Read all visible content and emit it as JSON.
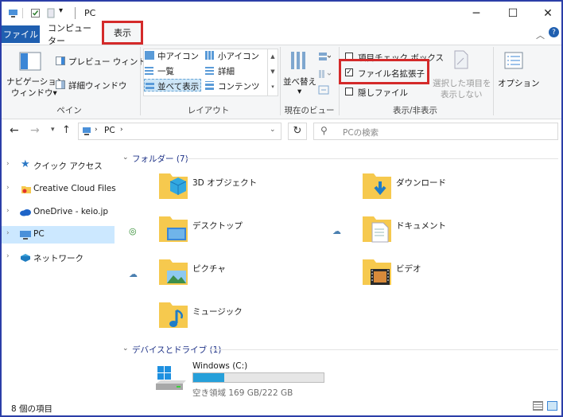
{
  "titlebar": {
    "title": "PC"
  },
  "tabs": {
    "file": "ファイル",
    "computer": "コンピューター",
    "view": "表示"
  },
  "ribbon": {
    "pane": {
      "nav_pane_line1": "ナビゲーション",
      "nav_pane_line2": "ウィンドウ▾",
      "preview": "プレビュー ウィンドウ",
      "details": "詳細ウィンドウ",
      "label": "ペイン"
    },
    "layout": {
      "medium_icons": "中アイコン",
      "small_icons": "小アイコン",
      "list": "一覧",
      "details": "詳細",
      "tiles": "並べて表示",
      "content": "コンテンツ",
      "label": "レイアウト"
    },
    "current_view": {
      "sort_line1": "並べ替え",
      "sort_line2": "▾",
      "label": "現在のビュー"
    },
    "show_hide": {
      "item_checkboxes": "項目チェック ボックス",
      "file_extensions": "ファイル名拡張子",
      "hidden_items": "隠しファイル",
      "hide_selected_line1": "選択した項目を",
      "hide_selected_line2": "表示しない",
      "label": "表示/非表示"
    },
    "options": {
      "label": "オプション"
    }
  },
  "address": {
    "path": "PC",
    "search_placeholder": "PCの検索"
  },
  "nav": {
    "items": [
      {
        "label": "クイック アクセス"
      },
      {
        "label": "Creative Cloud Files"
      },
      {
        "label": "OneDrive - keio.jp"
      },
      {
        "label": "PC"
      },
      {
        "label": "ネットワーク"
      }
    ]
  },
  "content": {
    "folders_header": "フォルダー (7)",
    "folders": [
      {
        "label": "3D オブジェクト"
      },
      {
        "label": "ダウンロード"
      },
      {
        "label": "デスクトップ"
      },
      {
        "label": "ドキュメント"
      },
      {
        "label": "ピクチャ"
      },
      {
        "label": "ビデオ"
      },
      {
        "label": "ミュージック"
      }
    ],
    "drives_header": "デバイスとドライブ (1)",
    "drive": {
      "name": "Windows (C:)",
      "free_text": "空き領域 169 GB/222 GB",
      "used_fraction": 0.24
    }
  },
  "status": {
    "count": "8 個の項目"
  },
  "colors": {
    "accent": "#1f5fb0",
    "highlight": "#d42a2a",
    "selection": "#cce8ff",
    "folder": "#f6c94e",
    "drive_bar": "#26a0da"
  }
}
